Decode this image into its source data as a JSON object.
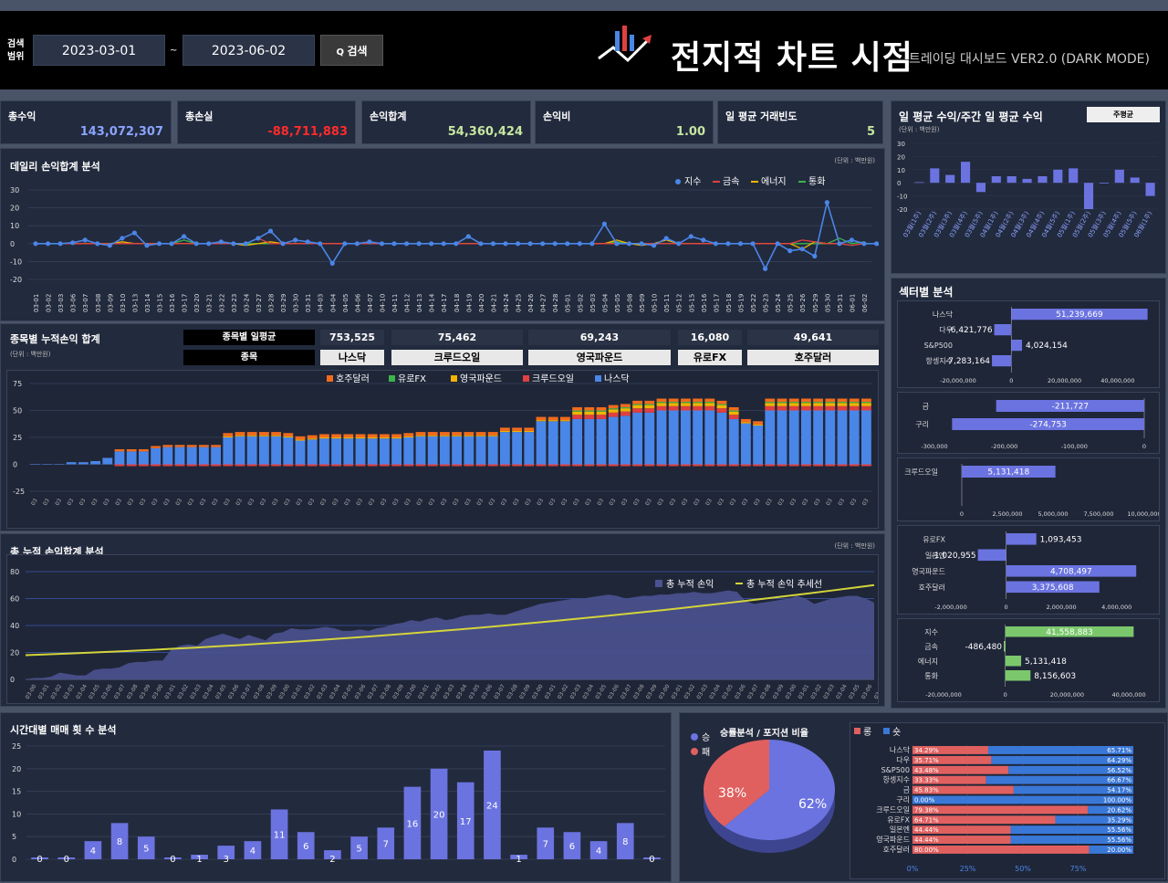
{
  "header": {
    "search_label": "검색 범위",
    "date_from": "2023-03-01",
    "date_sep": "~",
    "date_to": "2023-06-02",
    "search_button": "검색",
    "logo_text": "전지적 차트 시점",
    "subtitle": "트레이딩 대시보드 VER2.0 (DARK MODE)"
  },
  "kpis": [
    {
      "label": "총수익",
      "value": "143,072,307",
      "color": "#8aa4ff"
    },
    {
      "label": "총손실",
      "value": "-88,711,883",
      "color": "#ff2b2b"
    },
    {
      "label": "손익합계",
      "value": "54,360,424",
      "color": "#c6e6a0"
    },
    {
      "label": "손익비",
      "value": "1.00",
      "color": "#c6e6a0"
    },
    {
      "label": "일 평균 거래빈도",
      "value": "5",
      "color": "#c6e6a0"
    }
  ],
  "daily": {
    "title": "데일리 손익합계 분석",
    "unit": "(단위 : 백만원)",
    "legend": [
      {
        "name": "지수",
        "color": "#4a86e8"
      },
      {
        "name": "금속",
        "color": "#e04040"
      },
      {
        "name": "에너지",
        "color": "#f0b400"
      },
      {
        "name": "통화",
        "color": "#3cb44b"
      }
    ],
    "yticks": [
      "30",
      "20",
      "10",
      "0",
      "-10",
      "-20"
    ],
    "dates": [
      "03-01",
      "03-02",
      "03-03",
      "03-06",
      "03-07",
      "03-08",
      "03-09",
      "03-10",
      "03-13",
      "03-14",
      "03-15",
      "03-16",
      "03-17",
      "03-20",
      "03-21",
      "03-22",
      "03-23",
      "03-24",
      "03-27",
      "03-28",
      "03-29",
      "03-30",
      "03-31",
      "04-03",
      "04-04",
      "04-05",
      "04-06",
      "04-07",
      "04-10",
      "04-11",
      "04-12",
      "04-13",
      "04-14",
      "04-17",
      "04-18",
      "04-19",
      "04-20",
      "04-21",
      "04-24",
      "04-25",
      "04-26",
      "04-27",
      "04-28",
      "05-01",
      "05-02",
      "05-03",
      "05-04",
      "05-05",
      "05-08",
      "05-09",
      "05-10",
      "05-11",
      "05-12",
      "05-15",
      "05-16",
      "05-17",
      "05-18",
      "05-19",
      "05-22",
      "05-23",
      "05-24",
      "05-25",
      "05-26",
      "05-29",
      "05-30",
      "05-31",
      "06-01",
      "06-02"
    ],
    "index": [
      0,
      0,
      0,
      0.5,
      2,
      0,
      -1,
      3,
      6,
      -1,
      0,
      0,
      4,
      0,
      0,
      1,
      0,
      0,
      3,
      7,
      0,
      2,
      1,
      0,
      -11,
      0,
      0,
      1,
      0,
      0,
      0,
      0,
      0,
      0,
      0,
      4,
      0,
      0,
      0,
      0,
      0,
      0,
      0,
      0,
      0,
      0,
      11,
      0,
      0,
      0,
      -1,
      3,
      0,
      4,
      2,
      0,
      0,
      0,
      0,
      -14,
      0,
      -4,
      -3,
      -7,
      23,
      0,
      2,
      0,
      0,
      -5
    ],
    "metal": [
      0,
      0,
      0,
      0,
      0,
      0,
      0,
      0,
      0,
      0,
      0,
      0,
      0,
      0,
      0,
      0,
      0,
      0,
      3,
      0,
      0,
      0,
      0,
      0,
      0,
      0,
      0,
      0,
      0,
      0,
      0,
      0,
      0,
      0,
      0,
      0,
      0,
      0,
      0,
      0,
      0,
      0,
      0,
      0,
      0,
      0,
      0,
      0,
      0,
      0,
      0,
      0,
      0,
      0,
      0,
      0,
      0,
      0,
      0,
      0,
      0,
      0,
      2,
      1,
      0,
      0,
      -1,
      0
    ],
    "energy": [
      0,
      0,
      0,
      0,
      0,
      0,
      0,
      1,
      0,
      0,
      0,
      0,
      0,
      0,
      0,
      0,
      0,
      -1,
      0,
      1,
      0,
      0,
      0,
      0,
      0,
      0,
      0,
      0,
      0,
      0,
      0,
      0,
      0,
      0,
      0,
      0,
      0,
      0,
      0,
      0,
      0,
      0,
      0,
      0,
      0,
      0,
      0,
      2,
      0,
      -1,
      0,
      2,
      0,
      0,
      0,
      0,
      0,
      0,
      0,
      0,
      0,
      0,
      -3,
      1,
      0,
      0,
      2,
      0
    ],
    "currency": [
      0,
      0,
      0,
      0,
      0,
      0,
      0,
      0,
      0,
      0,
      0,
      0,
      2,
      0,
      0,
      1,
      0,
      0,
      0,
      0,
      0,
      0,
      0,
      0,
      0,
      0,
      0,
      0,
      0,
      0,
      0,
      0,
      0,
      0,
      0,
      0,
      0,
      0,
      0,
      0,
      0,
      0,
      0,
      0,
      0,
      0,
      0,
      1,
      0,
      0,
      0,
      0,
      0,
      0,
      0,
      0,
      0,
      0,
      0,
      0,
      0,
      0,
      0,
      0,
      0,
      3,
      0,
      1
    ]
  },
  "cum_items": {
    "title": "종목별 누적손익 합계",
    "unit": "(단위 : 백만원)",
    "avg_label": "종목별 일평균",
    "item_label": "종목",
    "avgs": [
      "753,525",
      "75,462",
      "69,243",
      "16,080",
      "49,641"
    ],
    "items": [
      "나스닥",
      "크루드오일",
      "영국파운드",
      "유로FX",
      "호주달러"
    ],
    "legend": [
      {
        "name": "호주달러",
        "color": "#f26b1d"
      },
      {
        "name": "유로FX",
        "color": "#3cb44b"
      },
      {
        "name": "영국파운드",
        "color": "#f0b400"
      },
      {
        "name": "크루드오일",
        "color": "#e04040"
      },
      {
        "name": "나스닥",
        "color": "#4a86e8"
      }
    ],
    "yticks": [
      "75",
      "50",
      "25",
      "0",
      "-25"
    ],
    "nasdaq": [
      0,
      0,
      0,
      2,
      2,
      3,
      6,
      12,
      12,
      12,
      15,
      16,
      16,
      16,
      16,
      16,
      25,
      26,
      26,
      26,
      26,
      25,
      22,
      23,
      24,
      24,
      24,
      24,
      24,
      24,
      24,
      25,
      26,
      26,
      26,
      26,
      26,
      26,
      26,
      30,
      30,
      30,
      40,
      40,
      40,
      42,
      42,
      42,
      44,
      45,
      48,
      48,
      50,
      50,
      50,
      50,
      50,
      48,
      42,
      38,
      36,
      50,
      50,
      50,
      50,
      50,
      50,
      50,
      50,
      50
    ]
  },
  "total": {
    "title": "총 누적 손익합계 분석",
    "unit": "(단위 : 백만원)",
    "legend": [
      {
        "name": "총 누적 손익",
        "color": "#4a5290"
      },
      {
        "name": "총 누적 손익 추세선",
        "color": "#d4d43a"
      }
    ],
    "yticks": [
      "80",
      "60",
      "40",
      "20",
      "0"
    ],
    "values": [
      0,
      1,
      1,
      2,
      5,
      4,
      3,
      3,
      7,
      8,
      8,
      9,
      12,
      13,
      13,
      14,
      14,
      22,
      25,
      26,
      25,
      30,
      32,
      34,
      32,
      30,
      33,
      31,
      29,
      34,
      35,
      38,
      37,
      37,
      38,
      39,
      38,
      36,
      36,
      37,
      36,
      38,
      39,
      41,
      42,
      44,
      43,
      45,
      46,
      44,
      45,
      47,
      48,
      48,
      49,
      48,
      48,
      50,
      52,
      54,
      56,
      57,
      58,
      59,
      60,
      60,
      61,
      62,
      63,
      62,
      60,
      61,
      62,
      62,
      63,
      63,
      64,
      64,
      65,
      64,
      64,
      65,
      66,
      65,
      58,
      56,
      57,
      58,
      59,
      60,
      62,
      60,
      56,
      58,
      60,
      61,
      62,
      62,
      60,
      57
    ]
  },
  "weekday": {
    "title": "일 평균 수익/주간 일 평균 수익",
    "unit": "(단위 : 백만원)",
    "button": "주평균",
    "yticks": [
      "30",
      "20",
      "10",
      "0",
      "-10",
      "-20"
    ],
    "labels": [
      "03월(1주)",
      "03월(2주)",
      "03월(3주)",
      "03월(4주)",
      "03월(5주)",
      "04월(1주)",
      "04월(2주)",
      "04월(3주)",
      "04월(4주)",
      "04월(5주)",
      "05월(1주)",
      "05월(2주)",
      "05월(3주)",
      "05월(4주)",
      "05월(5주)",
      "06월(1주)"
    ],
    "values": [
      0.5,
      11,
      6,
      16,
      -7,
      5,
      5,
      3,
      5,
      10,
      11,
      -20,
      0,
      10,
      4,
      -10
    ]
  },
  "sector": {
    "title": "섹터별 분석",
    "g1": {
      "labels": [
        "나스닥",
        "다우",
        "S&P500",
        "항셍지수"
      ],
      "values": [
        "51,239,669",
        "-6,421,776",
        "4,024,154",
        "-7,283,164"
      ],
      "nums": [
        51239669,
        -6421776,
        4024154,
        -7283164
      ],
      "ticks": [
        "-20,000,000",
        "0",
        "20,000,000",
        "40,000,000"
      ]
    },
    "g2": {
      "labels": [
        "금",
        "구리"
      ],
      "values": [
        "-211,727",
        "-274,753"
      ],
      "nums": [
        -211727,
        -274753
      ],
      "ticks": [
        "-300,000",
        "-200,000",
        "-100,000",
        "0"
      ]
    },
    "g3": {
      "labels": [
        "크루드오일"
      ],
      "values": [
        "5,131,418"
      ],
      "nums": [
        5131418
      ],
      "ticks": [
        "0",
        "2,500,000",
        "5,000,000",
        "7,500,000",
        "10,000,000"
      ]
    },
    "g4": {
      "labels": [
        "유로FX",
        "일본엔",
        "영국파운드",
        "호주달러"
      ],
      "values": [
        "1,093,453",
        "-1,020,955",
        "4,708,497",
        "3,375,608"
      ],
      "nums": [
        1093453,
        -1020955,
        4708497,
        3375608
      ],
      "ticks": [
        "-2,000,000",
        "0",
        "2,000,000",
        "4,000,000"
      ]
    },
    "g5": {
      "labels": [
        "지수",
        "금속",
        "에너지",
        "통화"
      ],
      "values": [
        "41,558,883",
        "-486,480",
        "5,131,418",
        "8,156,603"
      ],
      "nums": [
        41558883,
        -486480,
        5131418,
        8156603
      ],
      "ticks": [
        "-20,000,000",
        "0",
        "20,000,000",
        "40,000,000"
      ]
    }
  },
  "hourly": {
    "title": "시간대별 매매 횟 수 분석",
    "yticks": [
      "25",
      "20",
      "15",
      "10",
      "5",
      "0"
    ],
    "values": [
      0,
      0,
      4,
      8,
      5,
      0,
      1,
      3,
      4,
      11,
      6,
      2,
      5,
      7,
      16,
      20,
      17,
      24,
      1,
      7,
      6,
      4,
      8,
      0
    ]
  },
  "winrate": {
    "title": "승률분석 / 포지션 비율",
    "legend": [
      {
        "name": "승",
        "color": "#6b73e0"
      },
      {
        "name": "패",
        "color": "#e06060"
      }
    ],
    "win": "62%",
    "loss": "38%",
    "win_pct": 62,
    "pos_legend": [
      {
        "name": "롱",
        "color": "#e06060"
      },
      {
        "name": "숏",
        "color": "#3a78d8"
      }
    ],
    "rows": [
      {
        "name": "나스닥",
        "long": "34.29%",
        "short": "65.71%",
        "lv": 34.29
      },
      {
        "name": "다우",
        "long": "35.71%",
        "short": "64.29%",
        "lv": 35.71
      },
      {
        "name": "S&P500",
        "long": "43.48%",
        "short": "56.52%",
        "lv": 43.48
      },
      {
        "name": "항셍지수",
        "long": "33.33%",
        "short": "66.67%",
        "lv": 33.33
      },
      {
        "name": "금",
        "long": "45.83%",
        "short": "54.17%",
        "lv": 45.83
      },
      {
        "name": "구리",
        "long": "0.00%",
        "short": "100.00%",
        "lv": 0
      },
      {
        "name": "크루드오일",
        "long": "79.38%",
        "short": "20.62%",
        "lv": 79.38
      },
      {
        "name": "유로FX",
        "long": "64.71%",
        "short": "35.29%",
        "lv": 64.71
      },
      {
        "name": "일본엔",
        "long": "44.44%",
        "short": "55.56%",
        "lv": 44.44
      },
      {
        "name": "영국파운드",
        "long": "44.44%",
        "short": "55.56%",
        "lv": 44.44
      },
      {
        "name": "호주달러",
        "long": "80.00%",
        "short": "20.00%",
        "lv": 80
      }
    ],
    "xticks": [
      "0%",
      "25%",
      "50%",
      "75%"
    ]
  }
}
